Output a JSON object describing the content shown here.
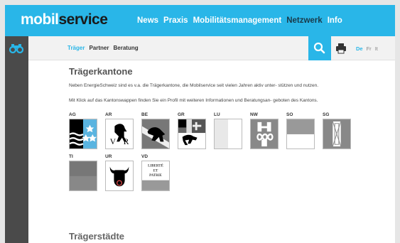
{
  "header": {
    "logo_part1": "mobil",
    "logo_part2": "service",
    "nav": [
      {
        "label": "News",
        "active": false
      },
      {
        "label": "Praxis",
        "active": false
      },
      {
        "label": "Mobilitätsmanagement",
        "active": false
      },
      {
        "label": "Netzwerk",
        "active": true
      },
      {
        "label": "Info",
        "active": false
      }
    ]
  },
  "sidebar": {
    "icon": "binoculars-icon"
  },
  "subbar": {
    "nav": [
      {
        "label": "Träger",
        "active": true
      },
      {
        "label": "Partner",
        "active": false
      },
      {
        "label": "Beratung",
        "active": false
      }
    ],
    "languages": [
      {
        "label": "De",
        "active": true
      },
      {
        "label": "Fr",
        "active": false
      },
      {
        "label": "It",
        "active": false
      }
    ]
  },
  "main": {
    "title": "Trägerkantone",
    "paragraph1": "Neben EnergieSchweiz sind es v.a. die Trägerkantone, die Mobilservice seit vielen Jahren aktiv unter- stützen und nutzen.",
    "paragraph2": "Mit Klick auf das Kantonswappen finden Sie ein Profil mit weiteren Informationen und Beratungsan- geboten des Kantons.",
    "cantons": [
      {
        "code": "AG"
      },
      {
        "code": "AR"
      },
      {
        "code": "BE"
      },
      {
        "code": "GR"
      },
      {
        "code": "LU"
      },
      {
        "code": "NW"
      },
      {
        "code": "SO"
      },
      {
        "code": "SG"
      },
      {
        "code": "TI"
      },
      {
        "code": "UR"
      },
      {
        "code": "VD"
      }
    ],
    "vd_motto": [
      "LIBERTÉ",
      "ET",
      "PATRIE"
    ],
    "section2_title": "Trägerstädte"
  },
  "colors": {
    "accent": "#29b6e8",
    "sidebar": "#4a4a4a"
  }
}
